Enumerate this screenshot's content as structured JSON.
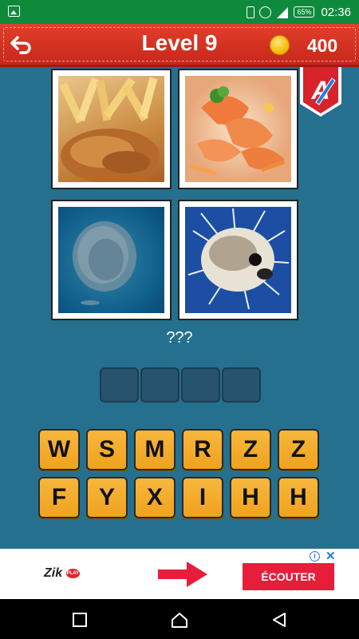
{
  "status_bar": {
    "battery": "65%",
    "time": "02:36",
    "icons": [
      "gallery-icon",
      "vibrate-icon",
      "alarm-icon",
      "signal-icon",
      "battery-icon"
    ]
  },
  "header": {
    "title": "Level 9",
    "coins": "400",
    "icons": [
      "back-arrow-icon",
      "coin-icon"
    ]
  },
  "hint_badge": {
    "letter": "A",
    "colors": {
      "badge": "#d8232a",
      "pencil": "#2b7bd6"
    }
  },
  "puzzle": {
    "photos": [
      "fish-and-chips",
      "shrimp-dish",
      "sardine-school",
      "pufferfish"
    ],
    "question": "???",
    "answer_length": 4
  },
  "letters": {
    "row1": [
      "W",
      "S",
      "M",
      "R",
      "Z",
      "Z"
    ],
    "row2": [
      "F",
      "Y",
      "X",
      "I",
      "H",
      "H"
    ]
  },
  "ad": {
    "logo_text": "Zik",
    "logo_badge": "PLAY",
    "cta": "ÉCOUTER",
    "info": "i",
    "close": "✕"
  },
  "nav": {
    "icons": [
      "recent-apps-icon",
      "home-icon",
      "back-icon"
    ]
  },
  "colors": {
    "background": "#25708f",
    "header": "#d2301f",
    "tile": "#f4ac2a",
    "status_bar": "#0f8a3c"
  }
}
